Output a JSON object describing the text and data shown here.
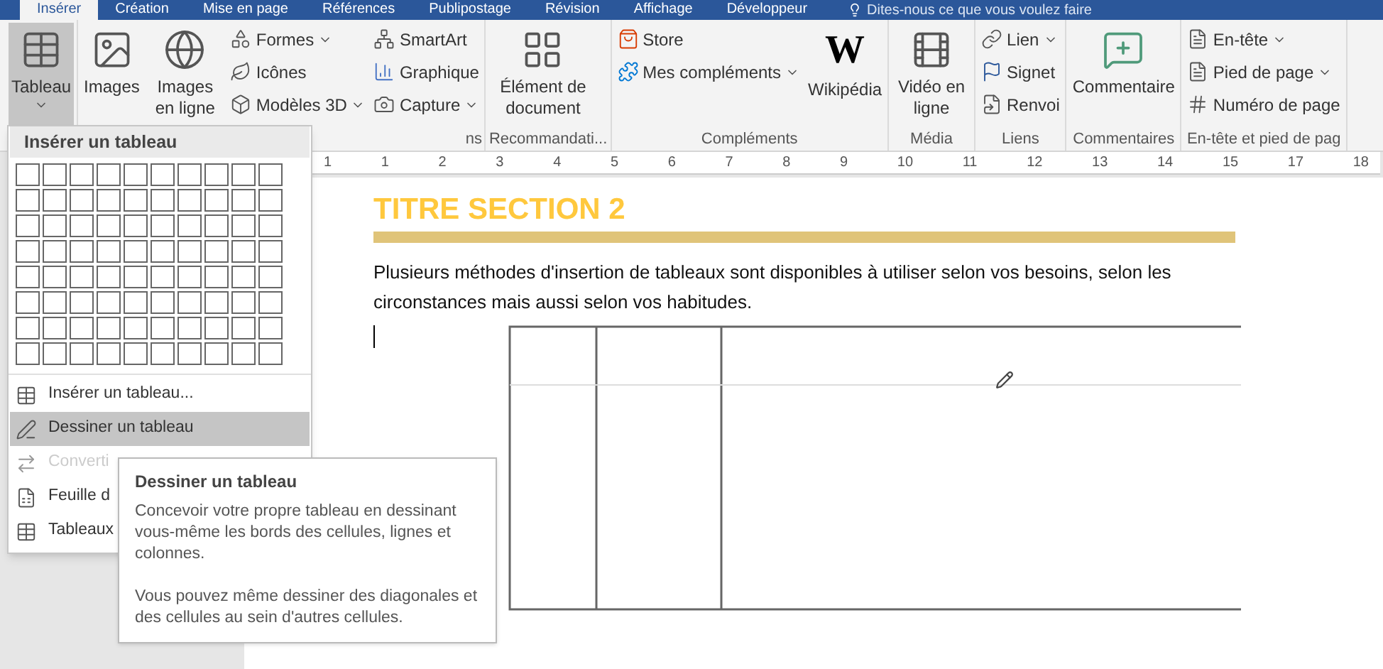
{
  "tabs": [
    {
      "label": "Insérer",
      "selected": true
    },
    {
      "label": "Création",
      "selected": false
    },
    {
      "label": "Mise en page",
      "selected": false
    },
    {
      "label": "Références",
      "selected": false
    },
    {
      "label": "Publipostage",
      "selected": false
    },
    {
      "label": "Révision",
      "selected": false
    },
    {
      "label": "Affichage",
      "selected": false
    },
    {
      "label": "Développeur",
      "selected": false
    }
  ],
  "tell_me": {
    "placeholder": "Dites-nous ce que vous voulez faire"
  },
  "ribbon_groups": [
    {
      "columns": [
        [
          {
            "label": "Tableau",
            "kind": "table",
            "dropdown": true,
            "pressed": true
          }
        ]
      ]
    },
    {
      "label": "ns",
      "columns": [
        [
          {
            "label": "Images",
            "kind": "picture",
            "dropdown": false,
            "pressed": false
          }
        ],
        [
          {
            "label": "Images en ligne",
            "kind": "online-picture",
            "dropdown": false,
            "pressed": false
          }
        ],
        [
          {
            "label": "Formes",
            "kind": "shapes",
            "dropdown": true,
            "pressed": false
          },
          {
            "label": "Icônes",
            "kind": "icons",
            "dropdown": false,
            "pressed": false
          },
          {
            "label": "Modèles 3D",
            "kind": "cube",
            "dropdown": true,
            "pressed": false
          }
        ],
        [
          {
            "label": "SmartArt",
            "kind": "smartart",
            "dropdown": false,
            "pressed": false
          },
          {
            "label": "Graphique",
            "kind": "chart",
            "dropdown": false,
            "pressed": false
          },
          {
            "label": "Capture",
            "kind": "capture",
            "dropdown": true,
            "pressed": false
          }
        ]
      ]
    },
    {
      "label": "Recommandati...",
      "columns": [
        [
          {
            "label": "Élément de document",
            "kind": "element",
            "dropdown": false,
            "pressed": false
          }
        ]
      ]
    },
    {
      "label": "Compléments",
      "columns": [
        [
          {
            "label": "Store",
            "kind": "store",
            "dropdown": false,
            "pressed": false
          },
          {
            "label": "Mes compléments",
            "kind": "addins",
            "dropdown": true,
            "pressed": false
          }
        ],
        [
          {
            "label": "Wikipédia",
            "glyph": "W",
            "kind": "wiki",
            "dropdown": false,
            "pressed": false
          }
        ]
      ]
    },
    {
      "label": "Média",
      "columns": [
        [
          {
            "label": "Vidéo en ligne",
            "kind": "video",
            "dropdown": false,
            "pressed": false
          }
        ]
      ]
    },
    {
      "label": "Liens",
      "columns": [
        [
          {
            "label": "Lien",
            "kind": "link",
            "dropdown": true,
            "pressed": false
          },
          {
            "label": "Signet",
            "kind": "flag",
            "dropdown": false,
            "pressed": false
          },
          {
            "label": "Renvoi",
            "kind": "crossref",
            "dropdown": false,
            "pressed": false
          }
        ]
      ]
    },
    {
      "label": "Commentaires",
      "columns": [
        [
          {
            "label": "Commentaire",
            "kind": "comment",
            "dropdown": false,
            "pressed": false
          }
        ]
      ]
    },
    {
      "label": "En-tête et pied de pag",
      "columns": [
        [
          {
            "label": "En-tête",
            "kind": "header",
            "dropdown": true,
            "pressed": false
          },
          {
            "label": "Pied de page",
            "kind": "footer",
            "dropdown": true,
            "pressed": false
          },
          {
            "label": "Numéro de page",
            "kind": "pagenum",
            "dropdown": false,
            "pressed": false
          }
        ]
      ]
    }
  ],
  "ruler": [
    "1",
    "1",
    "2",
    "3",
    "4",
    "5",
    "6",
    "7",
    "8",
    "9",
    "10",
    "11",
    "12",
    "13",
    "14",
    "15",
    "17",
    "18"
  ],
  "document": {
    "heading": "TITRE SECTION 2",
    "paragraph": "Plusieurs méthodes d'insertion de tableaux sont disponibles à utiliser selon vos besoins, selon les circonstances mais aussi selon vos habitudes."
  },
  "table_menu": {
    "title": "Insérer un tableau",
    "items": [
      {
        "label": "Insérer un tableau...",
        "kind": "table",
        "selected": false,
        "disabled": false
      },
      {
        "label": "Dessiner un tableau",
        "kind": "draw",
        "selected": true,
        "disabled": false
      },
      {
        "label": "Converti",
        "kind": "convert",
        "selected": false,
        "disabled": true
      },
      {
        "label": "Feuille d",
        "kind": "excel",
        "selected": false,
        "disabled": false
      },
      {
        "label": "Tableaux",
        "kind": "table",
        "selected": false,
        "disabled": false
      }
    ]
  },
  "tooltip": {
    "title": "Dessiner un tableau",
    "paragraphs": [
      "Concevoir votre propre tableau en dessinant vous-même les bords des cellules, lignes et colonnes.",
      "Vous pouvez même dessiner des diagonales et des cellules au sein d'autres cellules."
    ]
  }
}
